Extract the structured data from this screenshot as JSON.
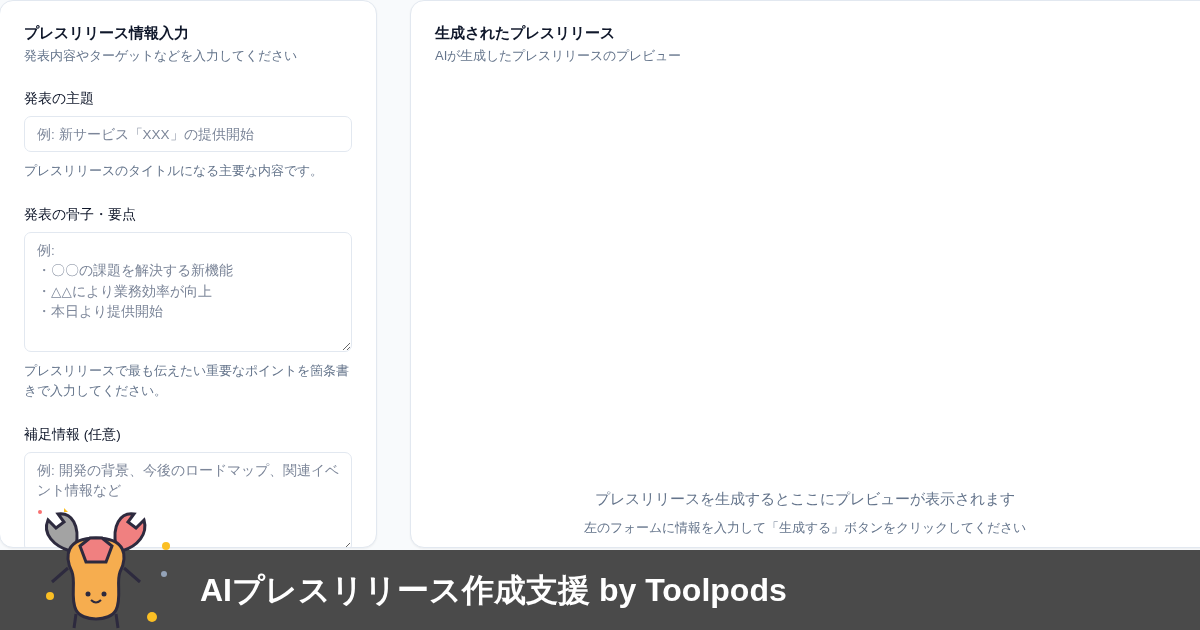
{
  "input_panel": {
    "title": "プレスリリース情報入力",
    "subtitle": "発表内容やターゲットなどを入力してください",
    "fields": [
      {
        "kind": "input",
        "label": "発表の主題",
        "placeholder": "例: 新サービス「XXX」の提供開始",
        "help": "プレスリリースのタイトルになる主要な内容です。"
      },
      {
        "kind": "textarea",
        "label": "発表の骨子・要点",
        "placeholder": [
          "例:",
          "・〇〇の課題を解決する新機能",
          "・△△により業務効率が向上",
          "・本日より提供開始"
        ],
        "help": "プレスリリースで最も伝えたい重要なポイントを箇条書きで入力してください。"
      },
      {
        "kind": "textarea",
        "label": "補足情報 (任意)",
        "placeholder": "例: 開発の背景、今後のロードマップ、関連イベント情報など"
      }
    ]
  },
  "preview_panel": {
    "title": "生成されたプレスリリース",
    "subtitle": "AIが生成したプレスリリースのプレビュー",
    "empty_message": "プレスリリースを生成するとここにプレビューが表示されます",
    "empty_hint": "左のフォームに情報を入力して「生成する」ボタンをクリックしてください"
  },
  "banner": {
    "title": "AIプレスリリース作成支援 by Toolpods"
  }
}
